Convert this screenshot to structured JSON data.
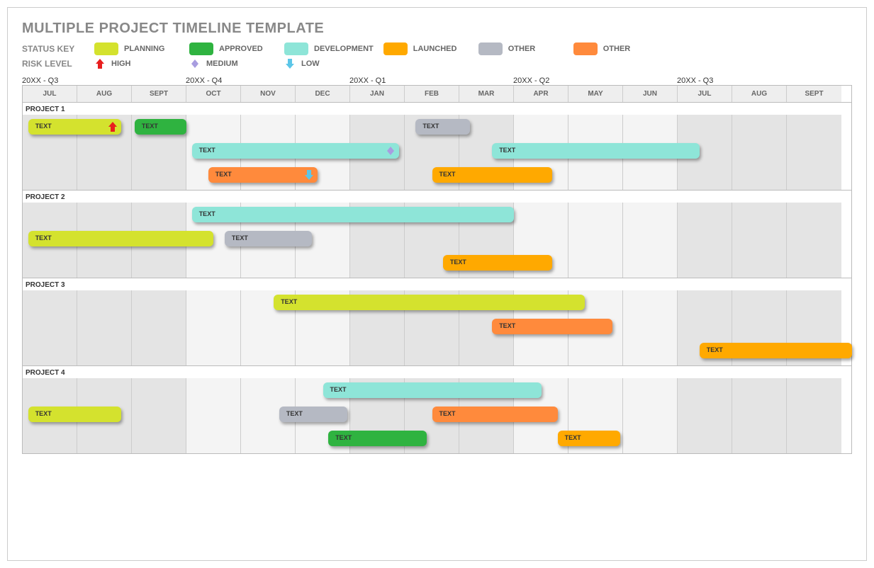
{
  "title": "MULTIPLE PROJECT TIMELINE TEMPLATE",
  "statusKeyLabel": "STATUS KEY",
  "riskLevelLabel": "RISK LEVEL",
  "legend": {
    "planning": "PLANNING",
    "approved": "APPROVED",
    "development": "DEVELOPMENT",
    "launched": "LAUNCHED",
    "other1": "OTHER",
    "other2": "OTHER"
  },
  "risk": {
    "high": "HIGH",
    "medium": "MEDIUM",
    "low": "LOW"
  },
  "quarters": [
    "20XX - Q3",
    "20XX - Q4",
    "20XX - Q1",
    "20XX - Q2",
    "20XX - Q3"
  ],
  "months": [
    "JUL",
    "AUG",
    "SEPT",
    "OCT",
    "NOV",
    "DEC",
    "JAN",
    "FEB",
    "MAR",
    "APR",
    "MAY",
    "JUN",
    "JUL",
    "AUG",
    "SEPT"
  ],
  "projectLabels": [
    "PROJECT 1",
    "PROJECT 2",
    "PROJECT 3",
    "PROJECT 4"
  ],
  "barLabel": "TEXT",
  "colors": {
    "planning": "#d4e22e",
    "approved": "#2fb340",
    "development": "#8ee5d8",
    "launched": "#ffa900",
    "other1": "#b5b9c3",
    "other2": "#ff8a3c"
  },
  "chart_data": {
    "type": "bar",
    "orientation": "gantt",
    "x_categories_months": [
      "JUL",
      "AUG",
      "SEPT",
      "OCT",
      "NOV",
      "DEC",
      "JAN",
      "FEB",
      "MAR",
      "APR",
      "MAY",
      "JUN",
      "JUL",
      "AUG",
      "SEPT"
    ],
    "quarters": [
      "20XX - Q3",
      "20XX - Q4",
      "20XX - Q1",
      "20XX - Q2",
      "20XX - Q3"
    ],
    "status_categories": [
      "planning",
      "approved",
      "development",
      "launched",
      "other1",
      "other2"
    ],
    "risk_levels": [
      "high",
      "medium",
      "low"
    ],
    "projects": [
      {
        "name": "PROJECT 1",
        "lanes": 3,
        "tasks": [
          {
            "label": "TEXT",
            "status": "planning",
            "lane": 0,
            "start_month": 0.1,
            "end_month": 1.8,
            "risk": "high"
          },
          {
            "label": "TEXT",
            "status": "approved",
            "lane": 0,
            "start_month": 2.05,
            "end_month": 3.0
          },
          {
            "label": "TEXT",
            "status": "other1",
            "lane": 0,
            "start_month": 7.2,
            "end_month": 8.2
          },
          {
            "label": "TEXT",
            "status": "development",
            "lane": 1,
            "start_month": 3.1,
            "end_month": 6.9,
            "risk": "medium"
          },
          {
            "label": "TEXT",
            "status": "development",
            "lane": 1,
            "start_month": 8.6,
            "end_month": 12.4
          },
          {
            "label": "TEXT",
            "status": "other2",
            "lane": 2,
            "start_month": 3.4,
            "end_month": 5.4,
            "risk": "low"
          },
          {
            "label": "TEXT",
            "status": "launched",
            "lane": 2,
            "start_month": 7.5,
            "end_month": 9.7
          }
        ]
      },
      {
        "name": "PROJECT 2",
        "lanes": 3,
        "tasks": [
          {
            "label": "TEXT",
            "status": "development",
            "lane": 0,
            "start_month": 3.1,
            "end_month": 9.0
          },
          {
            "label": "TEXT",
            "status": "planning",
            "lane": 1,
            "start_month": 0.1,
            "end_month": 3.5
          },
          {
            "label": "TEXT",
            "status": "other1",
            "lane": 1,
            "start_month": 3.7,
            "end_month": 5.3
          },
          {
            "label": "TEXT",
            "status": "launched",
            "lane": 2,
            "start_month": 7.7,
            "end_month": 9.7
          }
        ]
      },
      {
        "name": "PROJECT 3",
        "lanes": 3,
        "tasks": [
          {
            "label": "TEXT",
            "status": "planning",
            "lane": 0,
            "start_month": 4.6,
            "end_month": 10.3
          },
          {
            "label": "TEXT",
            "status": "other2",
            "lane": 1,
            "start_month": 8.6,
            "end_month": 10.8
          },
          {
            "label": "TEXT",
            "status": "launched",
            "lane": 2,
            "start_month": 12.4,
            "end_month": 15.2
          }
        ]
      },
      {
        "name": "PROJECT 4",
        "lanes": 3,
        "tasks": [
          {
            "label": "TEXT",
            "status": "development",
            "lane": 0,
            "start_month": 5.5,
            "end_month": 9.5
          },
          {
            "label": "TEXT",
            "status": "planning",
            "lane": 1,
            "start_month": 0.1,
            "end_month": 1.8
          },
          {
            "label": "TEXT",
            "status": "other1",
            "lane": 1,
            "start_month": 4.7,
            "end_month": 5.95
          },
          {
            "label": "TEXT",
            "status": "other2",
            "lane": 1,
            "start_month": 7.5,
            "end_month": 9.8
          },
          {
            "label": "TEXT",
            "status": "approved",
            "lane": 2,
            "start_month": 5.6,
            "end_month": 7.4
          },
          {
            "label": "TEXT",
            "status": "launched",
            "lane": 2,
            "start_month": 9.8,
            "end_month": 10.95
          }
        ]
      }
    ]
  }
}
